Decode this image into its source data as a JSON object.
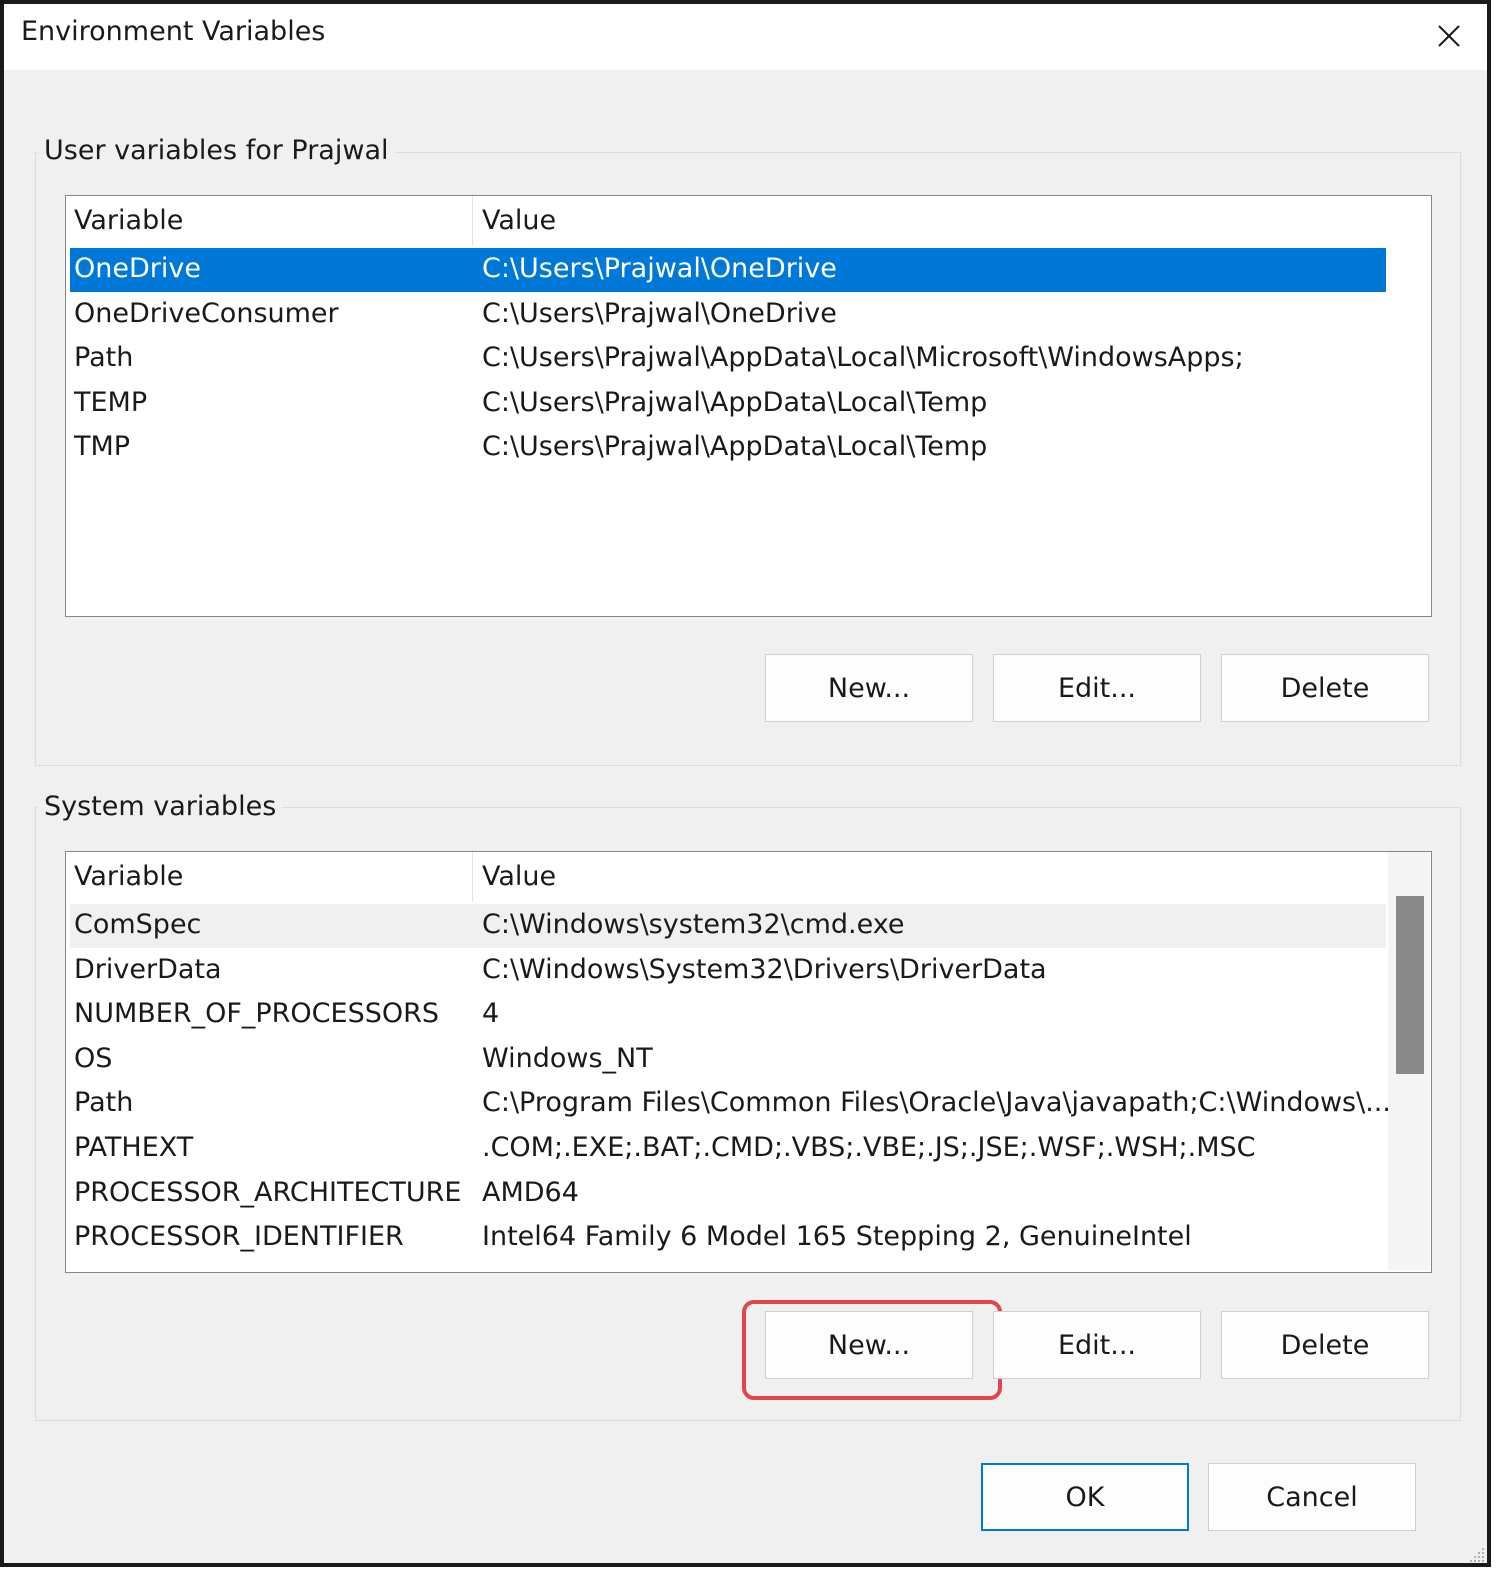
{
  "window": {
    "title": "Environment Variables",
    "close_icon": "close-icon"
  },
  "user_vars": {
    "group_label": "User variables for Prajwal",
    "columns": [
      "Variable",
      "Value"
    ],
    "rows": [
      {
        "variable": "OneDrive",
        "value": "C:\\Users\\Prajwal\\OneDrive",
        "selected": true
      },
      {
        "variable": "OneDriveConsumer",
        "value": "C:\\Users\\Prajwal\\OneDrive"
      },
      {
        "variable": "Path",
        "value": "C:\\Users\\Prajwal\\AppData\\Local\\Microsoft\\WindowsApps;"
      },
      {
        "variable": "TEMP",
        "value": "C:\\Users\\Prajwal\\AppData\\Local\\Temp"
      },
      {
        "variable": "TMP",
        "value": "C:\\Users\\Prajwal\\AppData\\Local\\Temp"
      }
    ],
    "buttons": {
      "new": "New...",
      "edit": "Edit...",
      "delete": "Delete"
    }
  },
  "system_vars": {
    "group_label": "System variables",
    "columns": [
      "Variable",
      "Value"
    ],
    "rows": [
      {
        "variable": "ComSpec",
        "value": "C:\\Windows\\system32\\cmd.exe",
        "hover": true
      },
      {
        "variable": "DriverData",
        "value": "C:\\Windows\\System32\\Drivers\\DriverData"
      },
      {
        "variable": "NUMBER_OF_PROCESSORS",
        "value": "4"
      },
      {
        "variable": "OS",
        "value": "Windows_NT"
      },
      {
        "variable": "Path",
        "value": "C:\\Program Files\\Common Files\\Oracle\\Java\\javapath;C:\\Windows\\..."
      },
      {
        "variable": "PATHEXT",
        "value": ".COM;.EXE;.BAT;.CMD;.VBS;.VBE;.JS;.JSE;.WSF;.WSH;.MSC"
      },
      {
        "variable": "PROCESSOR_ARCHITECTURE",
        "value": "AMD64"
      },
      {
        "variable": "PROCESSOR_IDENTIFIER",
        "value": "Intel64 Family 6 Model 165 Stepping 2, GenuineIntel"
      }
    ],
    "buttons": {
      "new": "New...",
      "edit": "Edit...",
      "delete": "Delete"
    }
  },
  "footer": {
    "ok": "OK",
    "cancel": "Cancel"
  },
  "colors": {
    "selection": "#0078d7",
    "highlight_box": "#e0474c"
  }
}
